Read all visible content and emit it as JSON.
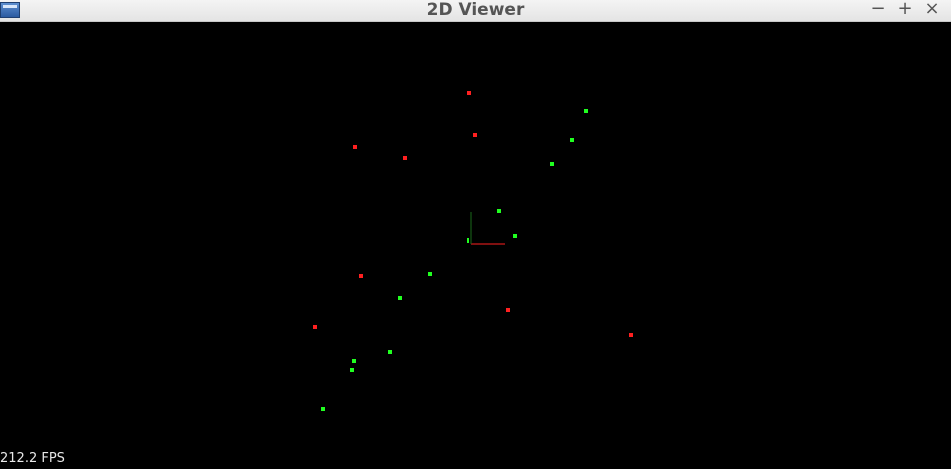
{
  "window": {
    "title": "2D Viewer",
    "minimize_label": "−",
    "maximize_label": "+",
    "close_label": "×",
    "icon": "app-window-icon"
  },
  "status": {
    "fps_text": "212.2 FPS"
  },
  "colors": {
    "background": "#000000",
    "red_point": "#ff2020",
    "green_point": "#20ff20",
    "axis_x": "#ff2020",
    "axis_y": "#20ff20"
  }
}
